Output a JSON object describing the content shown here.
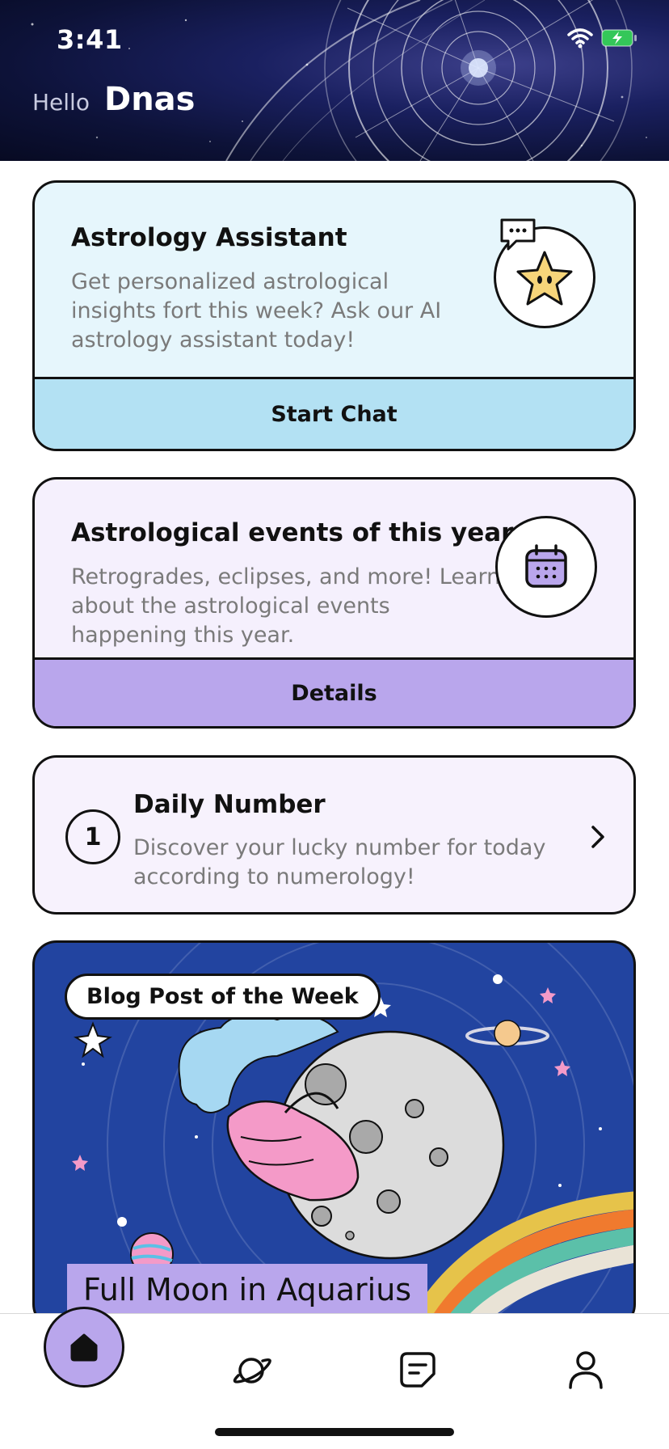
{
  "status": {
    "time": "3:41"
  },
  "header": {
    "hello": "Hello",
    "username": "Dnas"
  },
  "assistant": {
    "title": "Astrology Assistant",
    "description_lines": [
      "Get personalized astrological",
      "insights fort this week? Ask our AI",
      "astrology assistant today!"
    ],
    "action": "Start Chat",
    "icon": "star-chat-icon"
  },
  "events": {
    "title": "Astrological events of this year",
    "description_lines": [
      "Retrogrades, eclipses, and more! Learn",
      "about the astrological events",
      "happening this year."
    ],
    "action": "Details",
    "icon": "calendar-icon"
  },
  "daily_number": {
    "number": "1",
    "title": "Daily Number",
    "description_lines": [
      "Discover your lucky number for today",
      "according to numerology!"
    ],
    "icon": "chevron-right-icon"
  },
  "blog": {
    "badge": "Blog Post of the Week",
    "title": "Full Moon in Aquarius"
  },
  "nav": {
    "items": [
      {
        "name": "home",
        "icon": "home-icon",
        "active": true
      },
      {
        "name": "planet",
        "icon": "planet-icon",
        "active": false
      },
      {
        "name": "notes",
        "icon": "notes-icon",
        "active": false
      },
      {
        "name": "profile",
        "icon": "profile-icon",
        "active": false
      }
    ]
  },
  "colors": {
    "assistant_bg": "#e6f6fc",
    "assistant_action": "#b3e1f3",
    "events_bg": "#f5f0fd",
    "events_action": "#b9a6ec",
    "blog_bg": "#2244a0",
    "accent_purple": "#b9a6ec"
  }
}
